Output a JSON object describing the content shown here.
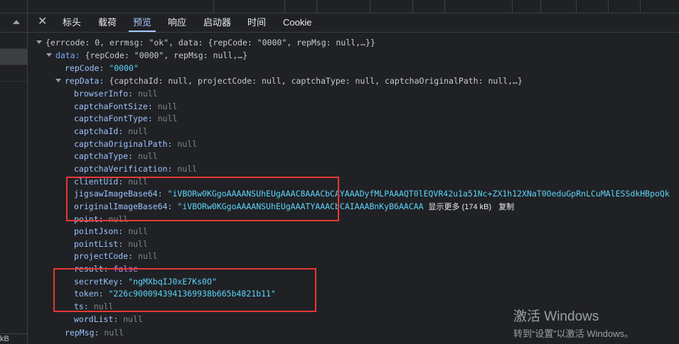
{
  "tabs": {
    "close_icon": "close-icon",
    "items": [
      "标头",
      "载荷",
      "预览",
      "响应",
      "启动器",
      "时间",
      "Cookie"
    ],
    "active_index": 2
  },
  "left_panel": {
    "footer_text": "kB"
  },
  "tree": {
    "root_summary": "{errcode: 0, errmsg: \"ok\", data: {repCode: \"0000\", repMsg: null,…}}",
    "data_key": "data:",
    "data_summary": "{repCode: \"0000\", repMsg: null,…}",
    "repCode_key": "repCode:",
    "repCode_value": "\"0000\"",
    "repData_key": "repData:",
    "repData_summary": "{captchaId: null, projectCode: null, captchaType: null, captchaOriginalPath: null,…}",
    "fields": [
      {
        "key": "browserInfo:",
        "value": "null",
        "type": "null"
      },
      {
        "key": "captchaFontSize:",
        "value": "null",
        "type": "null"
      },
      {
        "key": "captchaFontType:",
        "value": "null",
        "type": "null"
      },
      {
        "key": "captchaId:",
        "value": "null",
        "type": "null"
      },
      {
        "key": "captchaOriginalPath:",
        "value": "null",
        "type": "null"
      },
      {
        "key": "captchaType:",
        "value": "null",
        "type": "null"
      },
      {
        "key": "captchaVerification:",
        "value": "null",
        "type": "null"
      },
      {
        "key": "clientUid:",
        "value": "null",
        "type": "null"
      },
      {
        "key": "jigsawImageBase64:",
        "value": "\"iVBORw0KGgoAAAANSUhEUgAAAC8AAACbCAYAAADyfMLPAAAQT0lEQVR42u1a51Nc+ZX1h12XNaT0OeduGpRnLCuMAlESSdkHBpoQk",
        "type": "string"
      },
      {
        "key": "originalImageBase64:",
        "value": "\"iVBORw0KGgoAAAANSUhEUgAAATYAAACbCAIAAABnKyB6AACAA",
        "type": "string",
        "more": "显示更多 (174 kB)",
        "copy": "复制"
      },
      {
        "key": "point:",
        "value": "null",
        "type": "null"
      },
      {
        "key": "pointJson:",
        "value": "null",
        "type": "null"
      },
      {
        "key": "pointList:",
        "value": "null",
        "type": "null"
      },
      {
        "key": "projectCode:",
        "value": "null",
        "type": "null"
      },
      {
        "key": "result:",
        "value": "false",
        "type": "bool"
      },
      {
        "key": "secretKey:",
        "value": "\"ngMXbqIJ0xE7Ks0O\"",
        "type": "string"
      },
      {
        "key": "token:",
        "value": "\"226c9000943941369938b665b4821b11\"",
        "type": "string"
      },
      {
        "key": "ts:",
        "value": "null",
        "type": "null"
      },
      {
        "key": "wordList:",
        "value": "null",
        "type": "null"
      }
    ],
    "repMsg_key": "repMsg:",
    "repMsg_value": "null"
  },
  "watermark": {
    "line1": "激活 Windows",
    "line2": "转到“设置”以激活 Windows。"
  },
  "colors": {
    "highlight_box": "#e53935",
    "active_tab": "#a8c7fa"
  }
}
